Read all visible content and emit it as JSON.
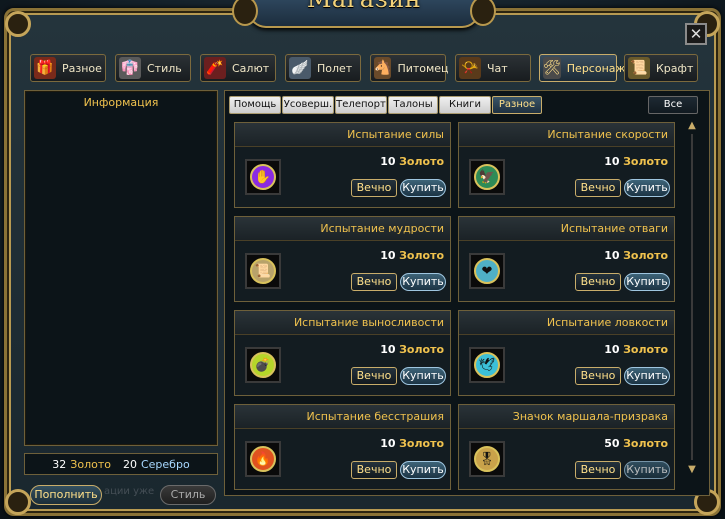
{
  "window": {
    "title": "Магазин",
    "close_label": "✕"
  },
  "categories": [
    {
      "label": "Разное",
      "icon": "gift-icon",
      "glyph": "🎁"
    },
    {
      "label": "Стиль",
      "icon": "outfit-icon",
      "glyph": "👘"
    },
    {
      "label": "Салют",
      "icon": "firework-icon",
      "glyph": "🧨"
    },
    {
      "label": "Полет",
      "icon": "wing-icon",
      "glyph": "🪽"
    },
    {
      "label": "Питомец",
      "icon": "horse-icon",
      "glyph": "🐴"
    },
    {
      "label": "Чат",
      "icon": "horn-icon",
      "glyph": "📯"
    },
    {
      "label": "Персонаж",
      "icon": "tools-icon",
      "glyph": "🛠",
      "active": true
    },
    {
      "label": "Крафт",
      "icon": "scroll-icon",
      "glyph": "📜"
    }
  ],
  "info": {
    "title": "Информация",
    "balance": {
      "gold_amount": "32",
      "gold_label": "Золото",
      "silver_amount": "20",
      "silver_label": "Серебро"
    },
    "refill_label": "Пополнить",
    "style_label": "Стиль",
    "ghost_text": "ации уже"
  },
  "subtabs": [
    {
      "label": "Помощь"
    },
    {
      "label": "Усоверш."
    },
    {
      "label": "Телепорт"
    },
    {
      "label": "Талоны"
    },
    {
      "label": "Книги"
    },
    {
      "label": "Разное",
      "active": true
    }
  ],
  "subtab_all": "Все",
  "items": [
    {
      "name": "Испытание силы",
      "price": "10",
      "currency": "Золото",
      "icon": "claw-icon",
      "color": "#8a2be2"
    },
    {
      "name": "Испытание скорости",
      "price": "10",
      "currency": "Золото",
      "icon": "wing-icon",
      "color": "#2e8b57"
    },
    {
      "name": "Испытание мудрости",
      "price": "10",
      "currency": "Золото",
      "icon": "scroll-icon",
      "color": "#b8a26a"
    },
    {
      "name": "Испытание отваги",
      "price": "10",
      "currency": "Золото",
      "icon": "heart-icon",
      "color": "#4fb0c6"
    },
    {
      "name": "Испытание выносливости",
      "price": "10",
      "currency": "Золото",
      "icon": "bomb-icon",
      "color": "#b5d62a"
    },
    {
      "name": "Испытание ловкости",
      "price": "10",
      "currency": "Золото",
      "icon": "wings-icon",
      "color": "#3cc0d8"
    },
    {
      "name": "Испытание бесстрашия",
      "price": "10",
      "currency": "Золото",
      "icon": "flame-icon",
      "color": "#e0521f"
    },
    {
      "name": "Значок маршала-призрака",
      "price": "50",
      "currency": "Золото",
      "icon": "badge-icon",
      "color": "#c9a24a"
    }
  ],
  "buttons": {
    "forever": "Вечно",
    "buy": "Купить"
  }
}
